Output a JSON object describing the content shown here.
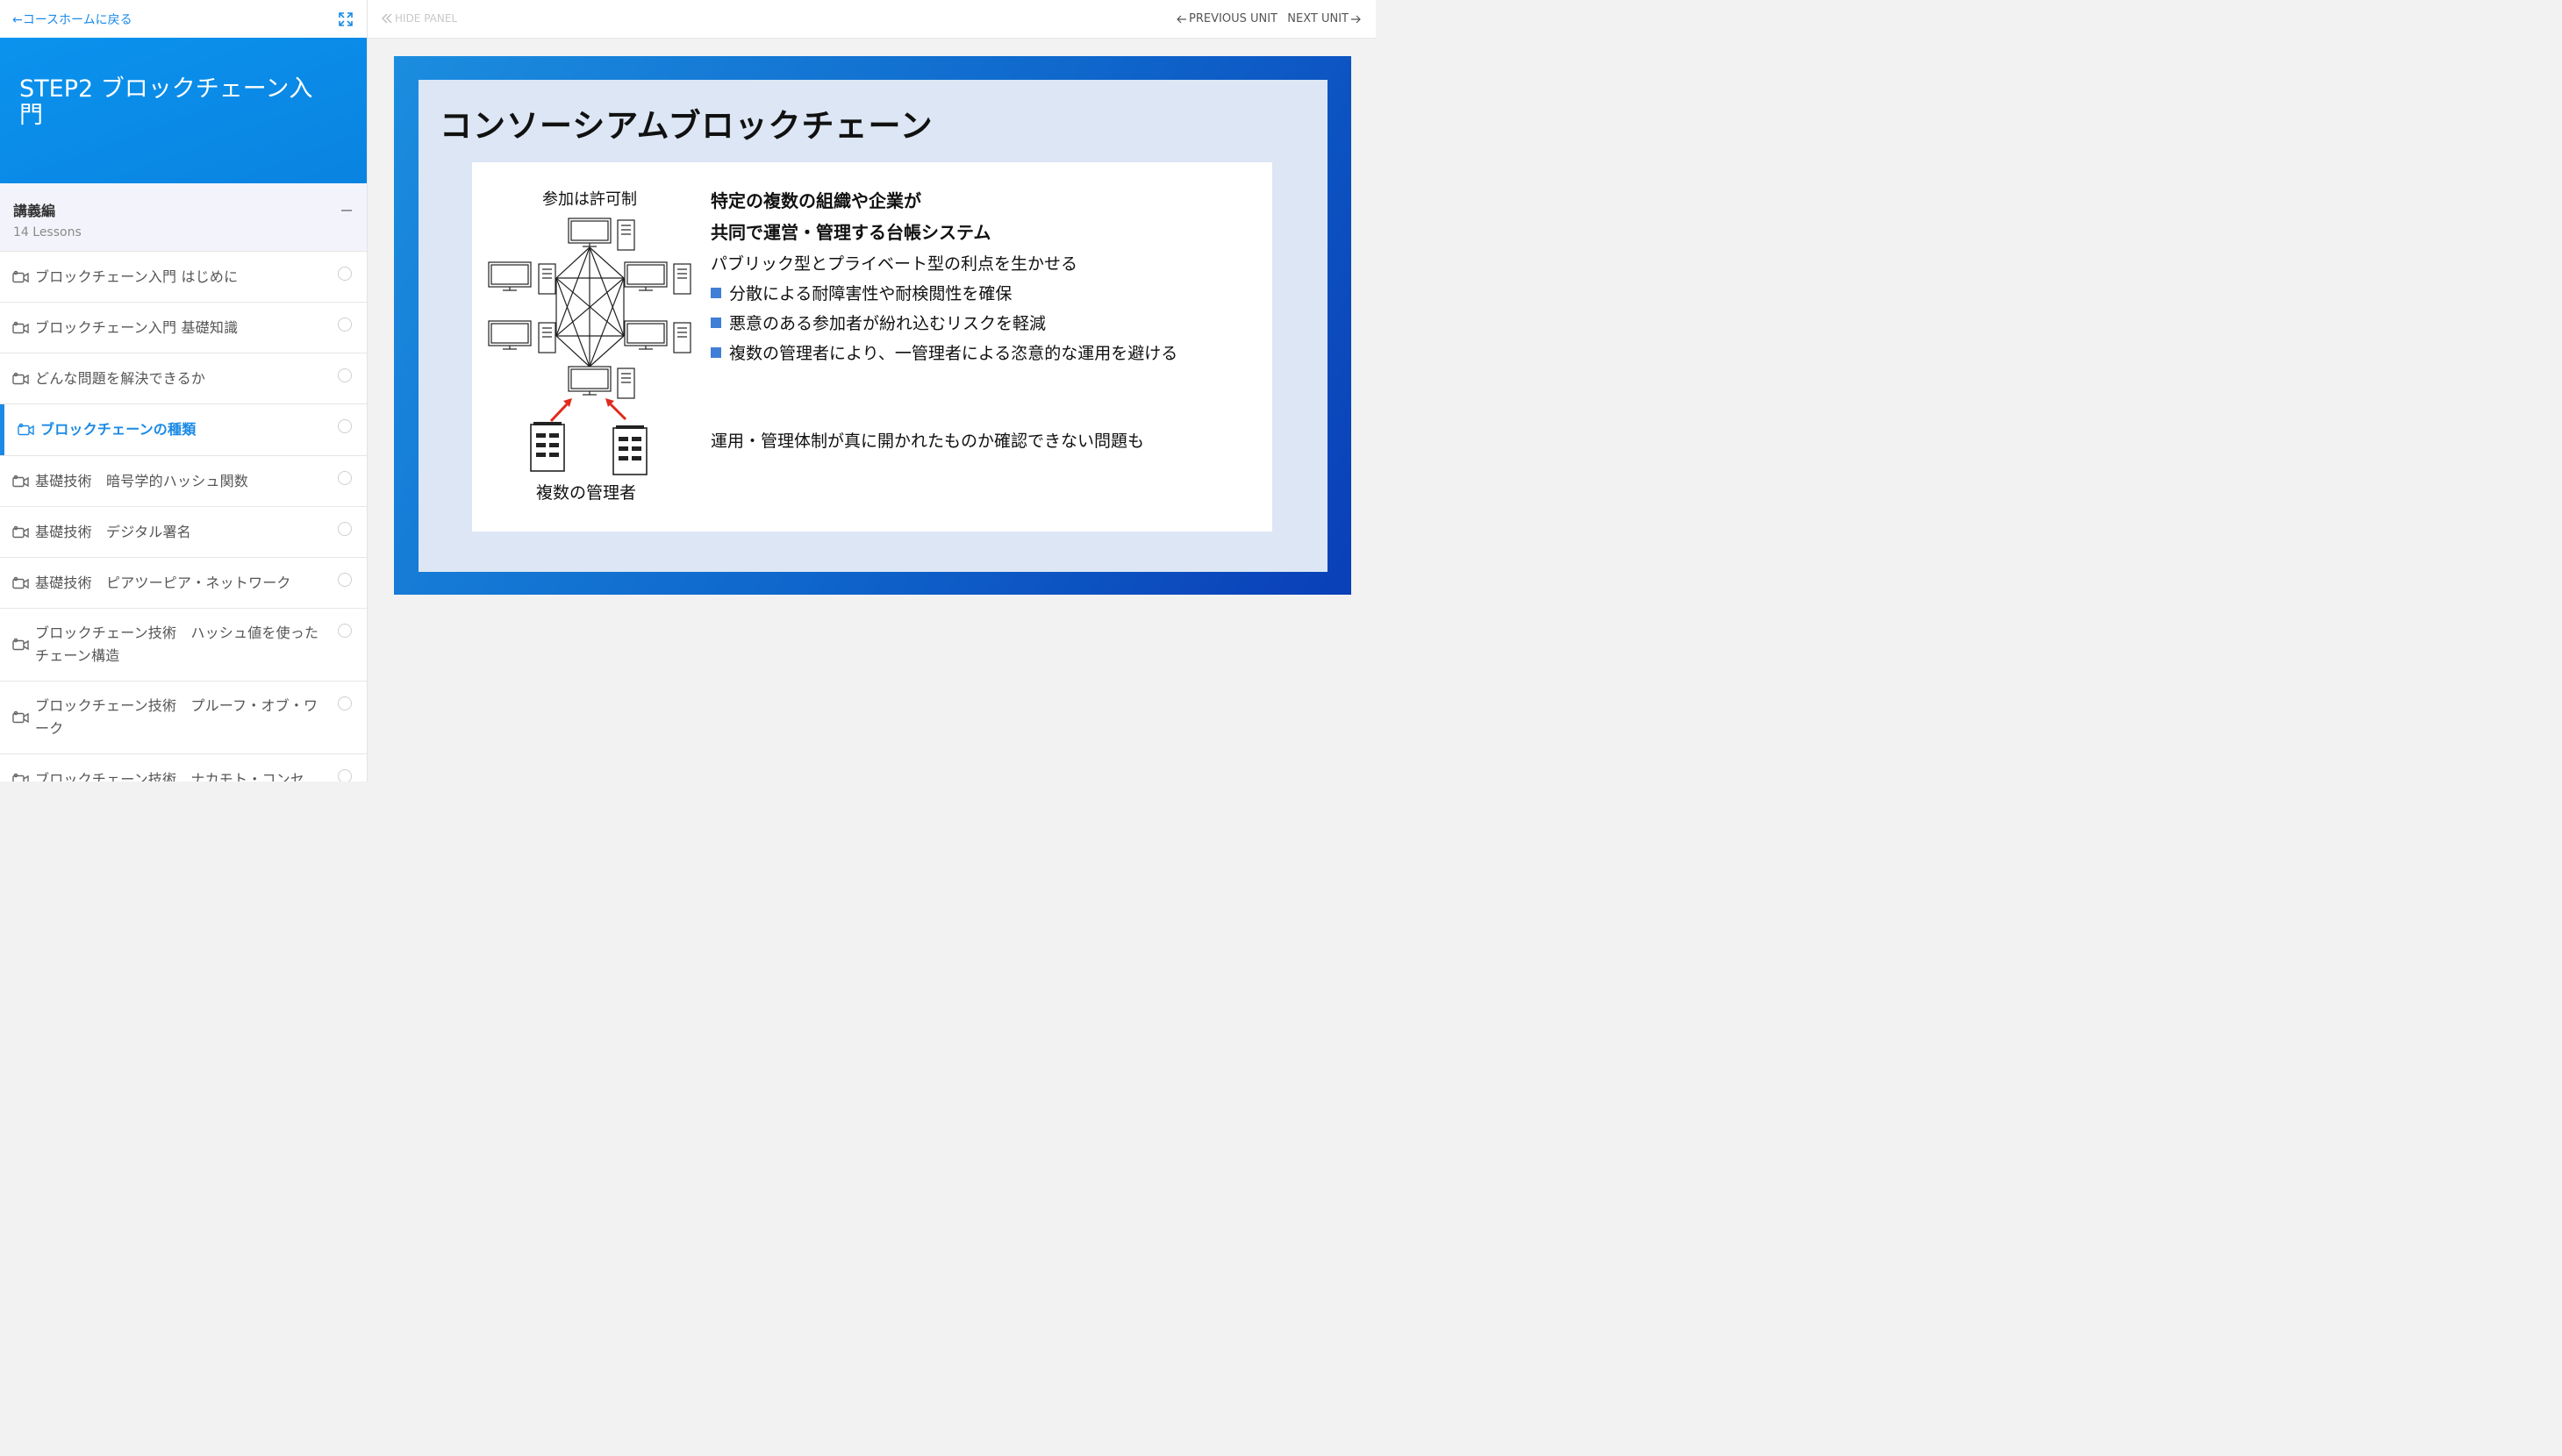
{
  "sidebar": {
    "back_label": "←コースホームに戻る",
    "course_title": "STEP2 ブロックチェーン入門",
    "section": {
      "title": "講義編",
      "count": "14 Lessons"
    },
    "lessons": [
      {
        "label": "ブロックチェーン入門 はじめに",
        "active": false
      },
      {
        "label": "ブロックチェーン入門 基礎知識",
        "active": false
      },
      {
        "label": "どんな問題を解決できるか",
        "active": false
      },
      {
        "label": "ブロックチェーンの種類",
        "active": true
      },
      {
        "label": "基礎技術　暗号学的ハッシュ関数",
        "active": false
      },
      {
        "label": "基礎技術　デジタル署名",
        "active": false
      },
      {
        "label": "基礎技術　ピアツーピア・ネットワーク",
        "active": false
      },
      {
        "label": "ブロックチェーン技術　ハッシュ値を使ったチェーン構造",
        "active": false
      },
      {
        "label": "ブロックチェーン技術　プルーフ・オブ・ワーク",
        "active": false
      },
      {
        "label": "ブロックチェーン技術　ナカモト・コンセ",
        "active": false
      }
    ]
  },
  "topbar": {
    "hide_panel": "HIDE PANEL",
    "prev_unit": "PREVIOUS UNIT",
    "next_unit": "NEXT UNIT"
  },
  "slide": {
    "title": "コンソーシアムブロックチェーン",
    "permission_label": "参加は許可制",
    "admins_label": "複数の管理者",
    "headline_1": "特定の複数の組織や企業が",
    "headline_2": "共同で運営・管理する台帳システム",
    "benefit": "パブリック型とプライベート型の利点を生かせる",
    "bullets": [
      "分散による耐障害性や耐検閲性を確保",
      "悪意のある参加者が紛れ込むリスクを軽減",
      "複数の管理者により、一管理者による恣意的な運用を避ける"
    ],
    "problem": "運用・管理体制が真に開かれたものか確認できない問題も"
  },
  "colors": {
    "accent": "#1a8ae6",
    "banner": "#0a8ae8",
    "bullet": "#3f7fd6",
    "arrow_red": "#e02a1c"
  }
}
